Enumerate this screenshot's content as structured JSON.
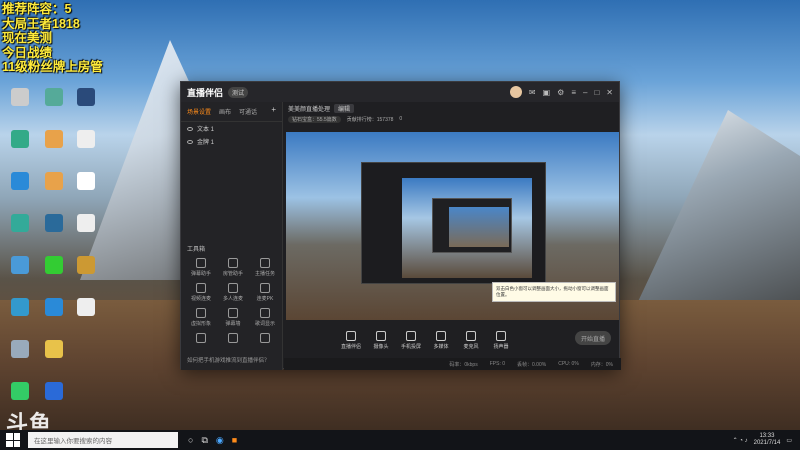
{
  "overlay": {
    "lines": [
      "推荐阵容：5",
      "大局王者1818",
      "现在美测",
      "今日战绩",
      "11级粉丝牌上房管"
    ]
  },
  "desktop_icons": [
    {
      "label": "",
      "color": "#888"
    },
    {
      "label": "",
      "color": "#5a9"
    },
    {
      "label": "",
      "color": "#3a7"
    },
    {
      "label": "",
      "color": "#2a6"
    },
    {
      "label": "",
      "color": "#e8a24a"
    },
    {
      "label": "",
      "color": "#2a8"
    },
    {
      "label": "",
      "color": "#3a9bd8"
    },
    {
      "label": "",
      "color": "#4c4"
    },
    {
      "label": "",
      "color": "#7ab"
    },
    {
      "label": "",
      "color": "#e8a24a"
    },
    {
      "label": "",
      "color": "#4a9"
    },
    {
      "label": "",
      "color": "#2a8ad8"
    }
  ],
  "window": {
    "title": "直播伴侣",
    "beta": "测试",
    "left_tabs": [
      "场景设置",
      "画布",
      "可通话"
    ],
    "scenes": [
      "文本 1",
      "金牌 1"
    ],
    "tools_title": "工具箱",
    "tools": [
      "弹幕助手",
      "房管助手",
      "主播任务",
      "视频连麦",
      "多人连麦",
      "连麦PK",
      "虚拟形象",
      "弹幕墙",
      "歌词显示",
      "",
      "",
      ""
    ],
    "tip": "如何把手机游戏推流到直播伴侣？",
    "main_tabs": [
      "美美颜直播处理",
      "编辑"
    ],
    "bar": [
      "钻石宝盒：55.5篇数",
      "贡献排行榜：157378",
      "0"
    ],
    "tooltip": "双击白色小窗可以调整画面大小，拖动小窗可以调整画面位置。",
    "bottom_tools": [
      "直播伴侣",
      "摄像头",
      "手机投屏",
      "多媒体",
      "麦克风",
      "扬声器"
    ],
    "live_button": "开始直播",
    "status": [
      "码率：0kbps",
      "FPS: 0",
      "丢帧：0.00%",
      "CPU: 0%",
      "内存：0%"
    ]
  },
  "taskbar": {
    "search_placeholder": "在这里输入你要搜索的内容",
    "time": "13:33",
    "date": "2021/7/14",
    "watermark": "斗鱼"
  }
}
